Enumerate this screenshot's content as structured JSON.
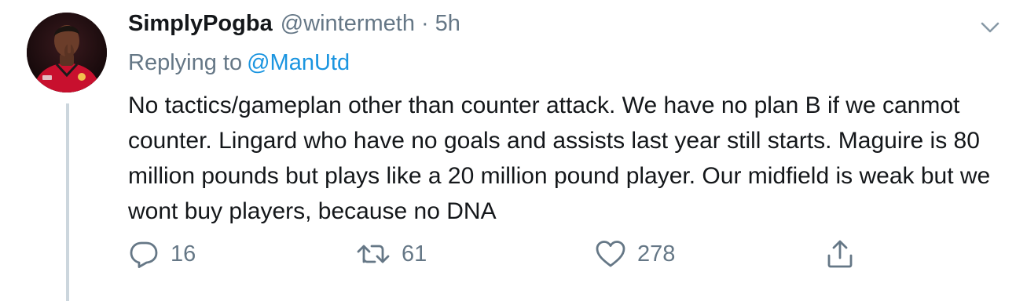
{
  "tweet": {
    "display_name": "SimplyPogba",
    "handle": "@wintermeth",
    "separator": "·",
    "time": "5h",
    "replying_prefix": "Replying to",
    "replying_to": "@ManUtd",
    "body": "No tactics/gameplan other than counter attack. We have no plan B if we canmot counter. Lingard who have no goals and assists last year still starts. Maguire is 80 million pounds but plays like a 20 million pound player. Our midfield is weak but we wont buy players, because no DNA"
  },
  "actions": {
    "reply_icon": "reply-icon",
    "reply_count": "16",
    "retweet_icon": "retweet-icon",
    "retweet_count": "61",
    "like_icon": "heart-icon",
    "like_count": "278",
    "share_icon": "share-icon"
  },
  "colors": {
    "text": "#14171a",
    "secondary": "#657786",
    "link": "#1b95e0",
    "thread_line": "#ccd6dd"
  }
}
